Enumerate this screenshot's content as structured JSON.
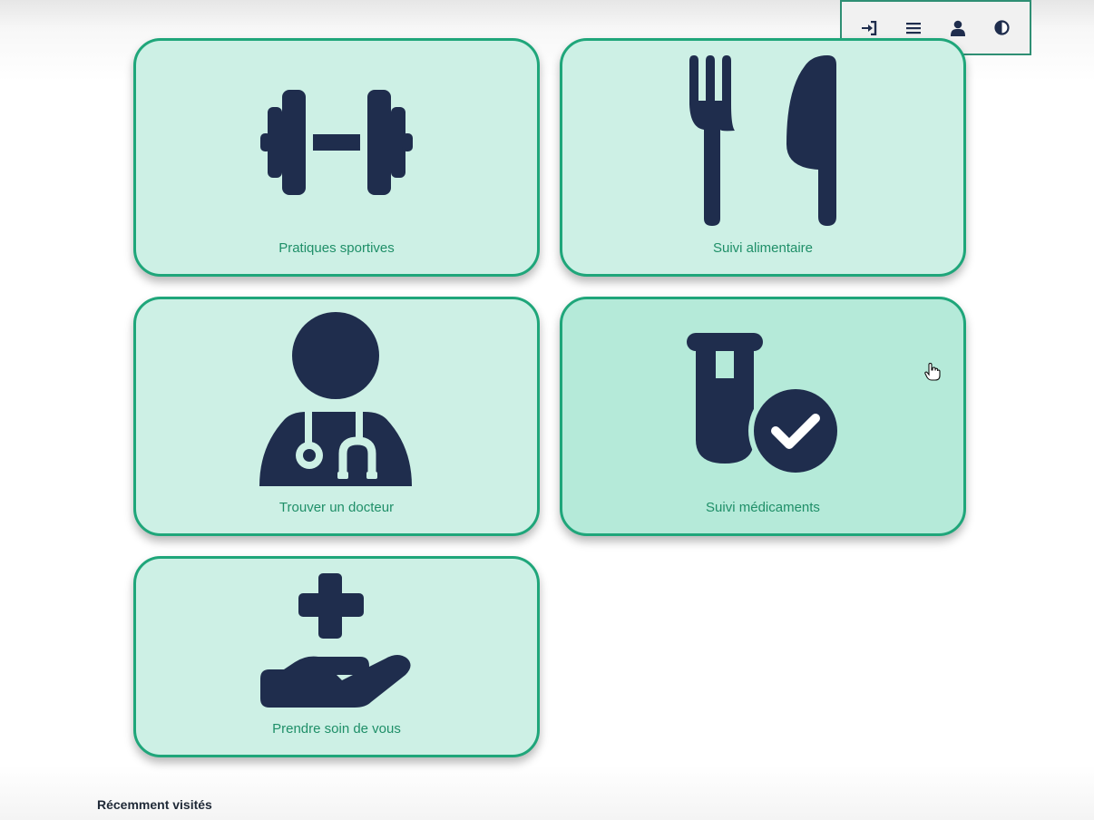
{
  "toolbar": {
    "buttons": [
      {
        "name": "login",
        "icon": "sign-in-icon"
      },
      {
        "name": "menu",
        "icon": "menu-icon"
      },
      {
        "name": "profile",
        "icon": "user-icon"
      },
      {
        "name": "contrast",
        "icon": "contrast-icon"
      }
    ]
  },
  "cards": [
    {
      "label": "Pratiques sportives",
      "icon": "dumbbell-icon"
    },
    {
      "label": "Suivi alimentaire",
      "icon": "utensils-icon"
    },
    {
      "label": "Trouver un docteur",
      "icon": "doctor-icon"
    },
    {
      "label": "Suivi médicaments",
      "icon": "vial-check-icon"
    },
    {
      "label": "Prendre soin de vous",
      "icon": "hand-care-icon"
    }
  ],
  "recent": {
    "title": "Récemment visités"
  },
  "colors": {
    "card_bg": "#cdf0e5",
    "card_hover_bg": "#b5ead9",
    "card_border": "#1fa67a",
    "icon": "#1f2d4d",
    "label": "#1f8f68"
  }
}
